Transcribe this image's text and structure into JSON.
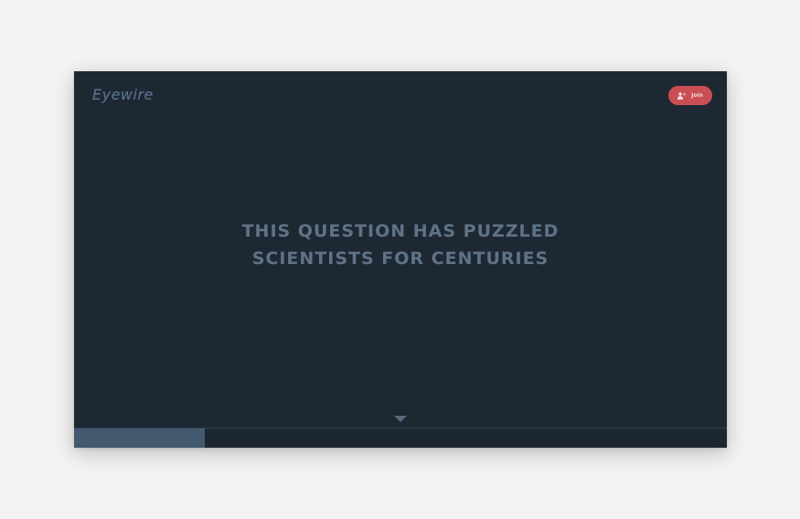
{
  "header": {
    "logo_text": "Eyewire",
    "join_label": "Join",
    "join_icon": "add-user-icon"
  },
  "hero": {
    "headline_line1": "THIS QUESTION HAS PUZZLED",
    "headline_line2": "SCIENTISTS FOR CENTURIES",
    "scroll_icon": "triangle-down-icon"
  },
  "progress": {
    "fraction": 0.2
  },
  "colors": {
    "background": "#1e2833",
    "accent": "#c94f55",
    "text_muted": "#5f7386",
    "progress_fill": "#42596f"
  }
}
